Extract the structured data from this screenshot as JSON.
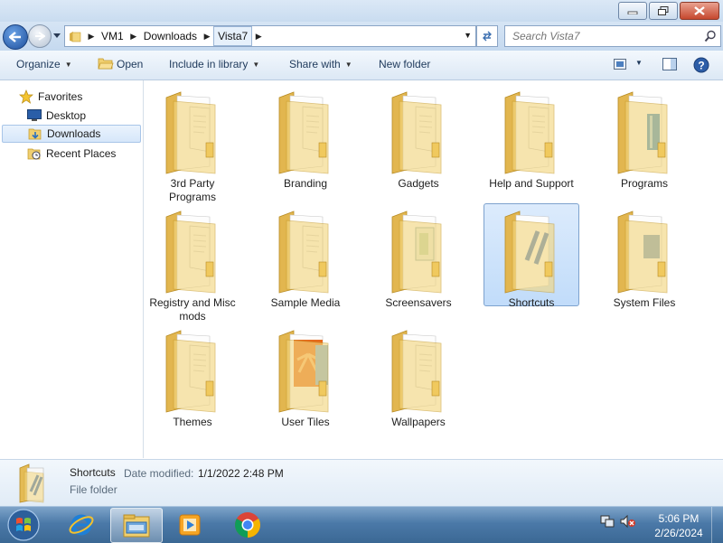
{
  "address": {
    "crumbs": [
      "VM1",
      "Downloads",
      "Vista7"
    ],
    "search_placeholder": "Search Vista7"
  },
  "toolbar": {
    "organize": "Organize",
    "open": "Open",
    "include_in_library": "Include in library",
    "share_with": "Share with",
    "new_folder": "New folder"
  },
  "nav": {
    "favorites": "Favorites",
    "items": [
      {
        "label": "Desktop",
        "icon": "desktop-icon"
      },
      {
        "label": "Downloads",
        "icon": "downloads-folder-icon",
        "selected": true
      },
      {
        "label": "Recent Places",
        "icon": "recent-places-icon"
      }
    ]
  },
  "folders": [
    {
      "name": "3rd Party Programs",
      "line1": "3rd Party",
      "line2": "Programs"
    },
    {
      "name": "Branding",
      "line1": "Branding",
      "line2": ""
    },
    {
      "name": "Gadgets",
      "line1": "Gadgets",
      "line2": ""
    },
    {
      "name": "Help and Support",
      "line1": "Help and Support",
      "line2": ""
    },
    {
      "name": "Programs",
      "line1": "Programs",
      "line2": ""
    },
    {
      "name": "Registry and Misc mods",
      "line1": "Registry and Misc",
      "line2": "mods"
    },
    {
      "name": "Sample Media",
      "line1": "Sample Media",
      "line2": ""
    },
    {
      "name": "Screensavers",
      "line1": "Screensavers",
      "line2": ""
    },
    {
      "name": "Shortcuts",
      "line1": "Shortcuts",
      "line2": "",
      "selected": true
    },
    {
      "name": "System Files",
      "line1": "System Files",
      "line2": ""
    },
    {
      "name": "Themes",
      "line1": "Themes",
      "line2": ""
    },
    {
      "name": "User Tiles",
      "line1": "User Tiles",
      "line2": ""
    },
    {
      "name": "Wallpapers",
      "line1": "Wallpapers",
      "line2": ""
    }
  ],
  "details": {
    "name": "Shortcuts",
    "modified_label": "Date modified:",
    "modified_value": "1/1/2022 2:48 PM",
    "type": "File folder"
  },
  "taskbar": {
    "time": "5:06 PM",
    "date": "2/26/2024",
    "apps": [
      "internet-explorer-icon",
      "windows-explorer-icon",
      "media-player-icon",
      "chrome-icon"
    ]
  },
  "colors": {
    "selection": "#c1dcfa",
    "folder_yellow": "#f2d27a",
    "taskbar": "#4b79a8"
  }
}
